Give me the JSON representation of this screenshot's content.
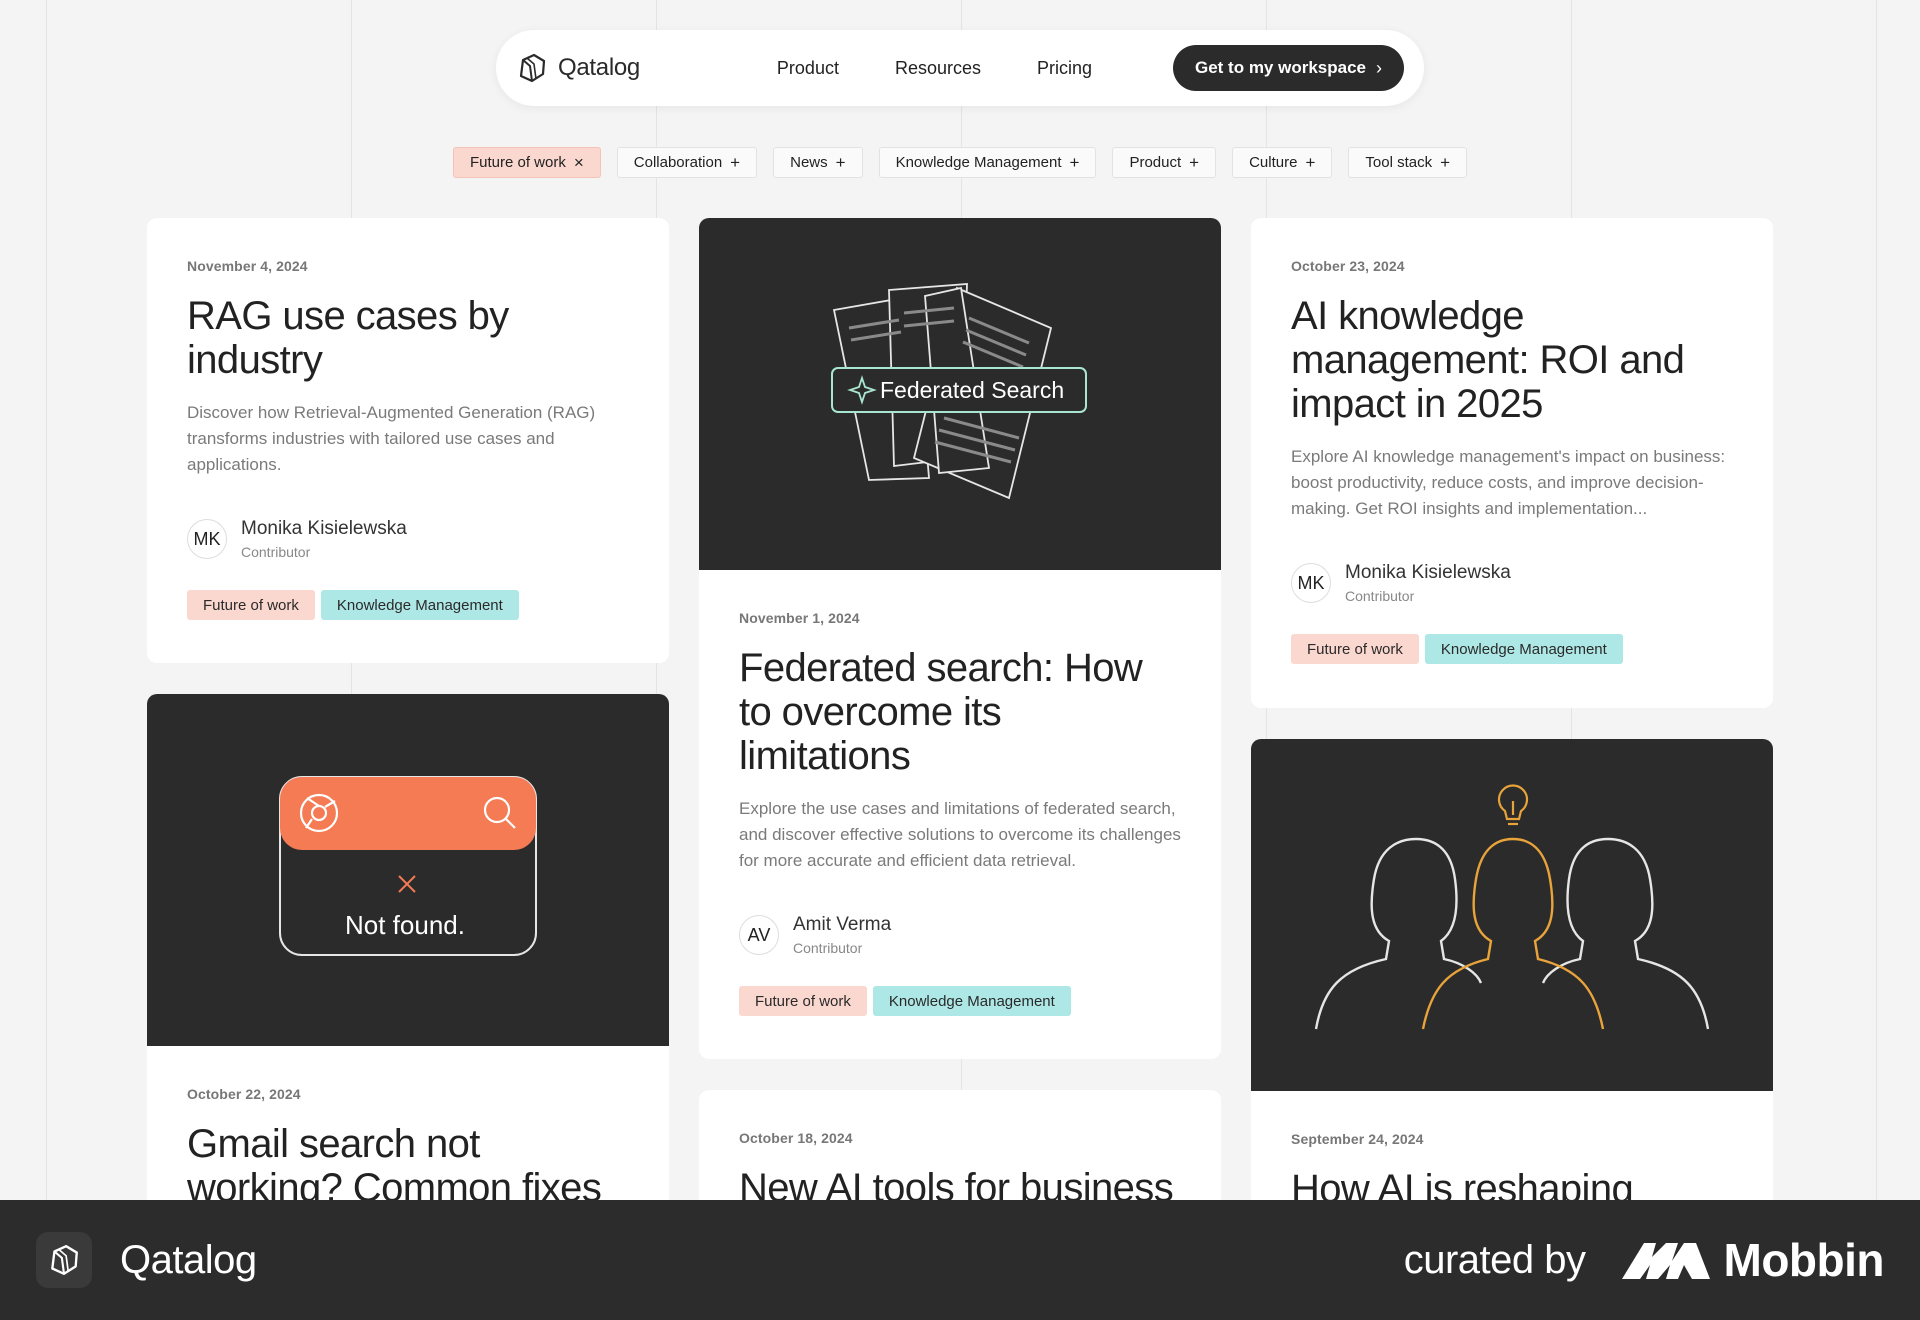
{
  "nav": {
    "brand": "Qatalog",
    "links": [
      "Product",
      "Resources",
      "Pricing"
    ],
    "cta": "Get to my workspace"
  },
  "filters": [
    {
      "label": "Future of work",
      "active": true
    },
    {
      "label": "Collaboration",
      "active": false
    },
    {
      "label": "News",
      "active": false
    },
    {
      "label": "Knowledge Management",
      "active": false
    },
    {
      "label": "Product",
      "active": false
    },
    {
      "label": "Culture",
      "active": false
    },
    {
      "label": "Tool stack",
      "active": false
    }
  ],
  "cards": {
    "rag": {
      "date": "November 4, 2024",
      "title": "RAG use cases by industry",
      "desc": "Discover how Retrieval-Augmented Generation (RAG) transforms industries with tailored use cases and applications.",
      "author_initials": "MK",
      "author_name": "Monika Kisielewska",
      "author_role": "Contributor",
      "tags": [
        "Future of work",
        "Knowledge Management"
      ]
    },
    "federated": {
      "hero_label": "Federated Search",
      "date": "November 1, 2024",
      "title": "Federated search: How to overcome its limitations",
      "desc": "Explore the use cases and limitations of federated search, and discover effective solutions to overcome its challenges for more accurate and efficient data retrieval.",
      "author_initials": "AV",
      "author_name": "Amit Verma",
      "author_role": "Contributor",
      "tags": [
        "Future of work",
        "Knowledge Management"
      ]
    },
    "ai_km": {
      "date": "October 23, 2024",
      "title": "AI knowledge management: ROI and impact in 2025",
      "desc": "Explore AI knowledge management's impact on business: boost productivity, reduce costs, and improve decision-making. Get ROI insights and implementation...",
      "author_initials": "MK",
      "author_name": "Monika Kisielewska",
      "author_role": "Contributor",
      "tags": [
        "Future of work",
        "Knowledge Management"
      ]
    },
    "gmail": {
      "hero_label": "Not found.",
      "date": "October 22, 2024",
      "title": "Gmail search not working? Common fixes"
    },
    "ai_tools": {
      "date": "October 18, 2024",
      "title": "New AI tools for business"
    },
    "reshaping": {
      "date": "September 24, 2024",
      "title": "How AI is reshaping"
    }
  },
  "footer": {
    "brand": "Qatalog",
    "curated": "curated by",
    "mobbin": "Mobbin"
  },
  "colors": {
    "accent_orange": "#f47b54",
    "tag_orange": "#fbd8cf",
    "tag_teal": "#aee8e6",
    "dark": "#2b2b2b",
    "hero_green": "#a8e6cf",
    "gold": "#e8a33a"
  }
}
